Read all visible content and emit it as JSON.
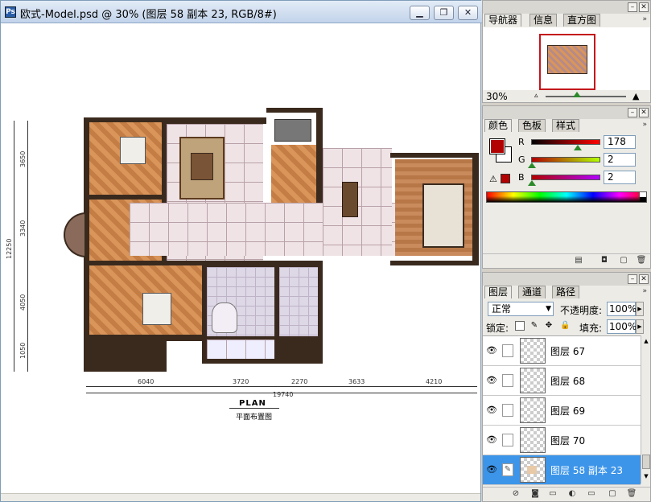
{
  "document": {
    "title": "欧式-Model.psd @ 30% (图层 58 副本 23, RGB/8#)",
    "buttons": {
      "minimize": "▁",
      "restore": "❐",
      "close": "✕"
    },
    "plan": {
      "title": "PLAN",
      "subtitle": "平面布置图",
      "bottom_dims": [
        "6040",
        "3720",
        "2270",
        "3633",
        "4210"
      ],
      "total_width": "19740",
      "left_dims": [
        "3650",
        "3340",
        "4050",
        "1050"
      ],
      "total_height": "12250"
    }
  },
  "navigator_panel": {
    "tabs": [
      "导航器",
      "信息",
      "直方图"
    ],
    "zoom": "30%",
    "border_color": "#c4161c"
  },
  "color_panel": {
    "tabs": [
      "颜色",
      "色板",
      "样式"
    ],
    "foreground": "#b20202",
    "channels": [
      {
        "label": "R",
        "value": "178",
        "level": 0.7
      },
      {
        "label": "G",
        "value": "2",
        "level": 0.01
      },
      {
        "label": "B",
        "value": "2",
        "level": 0.01
      }
    ]
  },
  "layers_panel": {
    "tabs": [
      "图层",
      "通道",
      "路径"
    ],
    "blend_mode": "正常",
    "opacity_label": "不透明度:",
    "opacity": "100%",
    "lock_label": "锁定:",
    "fill_label": "填充:",
    "fill": "100%",
    "layers": [
      {
        "name": "图层 67",
        "selected": false
      },
      {
        "name": "图层 68",
        "selected": false
      },
      {
        "name": "图层 69",
        "selected": false
      },
      {
        "name": "图层 70",
        "selected": false
      },
      {
        "name": "图层 58 副本 23",
        "selected": true
      }
    ],
    "selection_color": "#3d95e9"
  }
}
